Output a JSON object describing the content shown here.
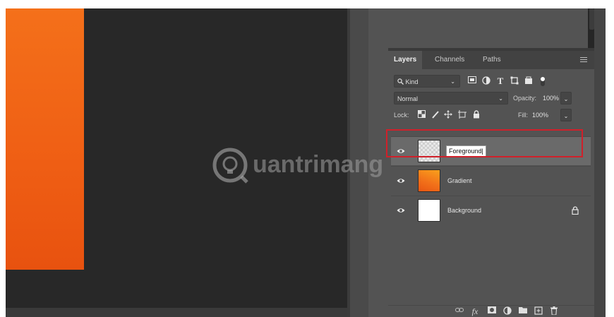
{
  "tabs": [
    {
      "label": "Layers",
      "active": true
    },
    {
      "label": "Channels",
      "active": false
    },
    {
      "label": "Paths",
      "active": false
    }
  ],
  "filter": {
    "kind_label": "Kind"
  },
  "blend": {
    "mode": "Normal",
    "opacity_label": "Opacity:",
    "opacity_value": "100%"
  },
  "lock": {
    "lock_label": "Lock:",
    "fill_label": "Fill:",
    "fill_value": "100%"
  },
  "layers": [
    {
      "name": "Foreground",
      "editing": true,
      "visible": true,
      "thumb": "transparent"
    },
    {
      "name": "Gradient",
      "editing": false,
      "visible": true,
      "thumb": "orange-gradient"
    },
    {
      "name": "Background",
      "editing": false,
      "visible": true,
      "thumb": "white",
      "locked": true
    }
  ],
  "watermark": {
    "text": "uantrimang"
  },
  "colors": {
    "canvas_orange": "#f0641a",
    "selection_outline": "#d0202a",
    "panel_bg": "#535353"
  }
}
